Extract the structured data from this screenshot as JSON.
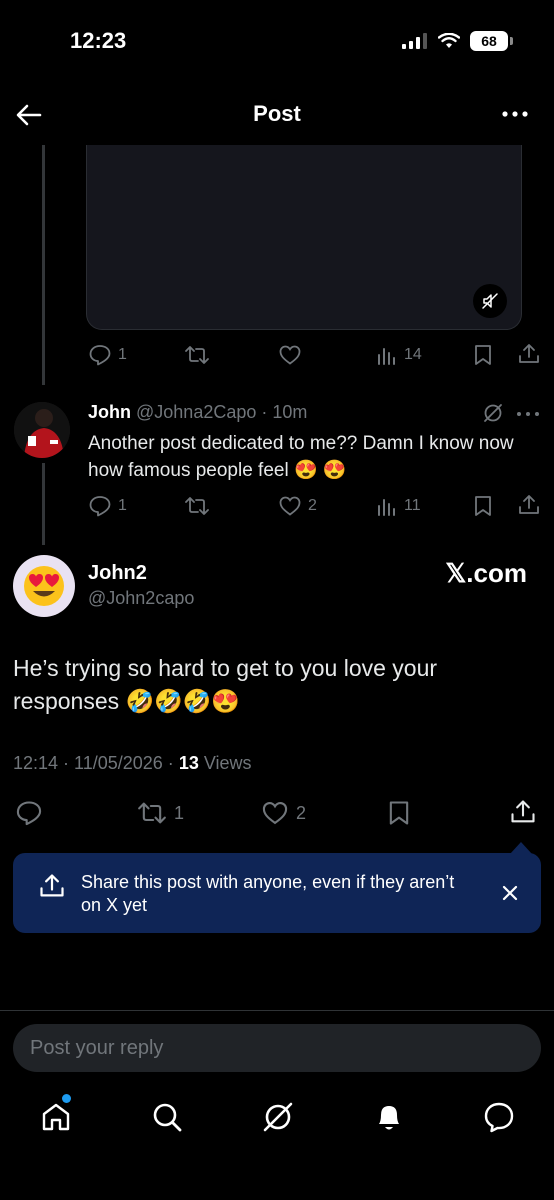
{
  "status_bar": {
    "time": "12:23",
    "battery": "68"
  },
  "header": {
    "title": "Post"
  },
  "media_post": {
    "actions": {
      "replies": "1",
      "views": "14"
    }
  },
  "reply": {
    "name": "John",
    "handle": "@Johna2Capo",
    "time": "· 10m",
    "text": "Another post dedicated to me?? Damn I know now how famous people feel 😍 😍",
    "actions": {
      "replies": "1",
      "likes": "2",
      "views": "11"
    }
  },
  "main_post": {
    "name": "John2",
    "handle": "@John2capo",
    "source": "𝕏.com",
    "text": "He’s trying so hard to get to you love your responses 🤣🤣🤣😍",
    "timestamp": "12:14 · 11/05/2026 ·",
    "views_count": "13",
    "views_label": "Views",
    "actions": {
      "reposts": "1",
      "likes": "2"
    }
  },
  "share_banner": {
    "text": "Share this post with anyone, even if they aren’t on X yet"
  },
  "reply_bar": {
    "placeholder": "Post your reply"
  },
  "nav": {
    "items": [
      "home-icon",
      "search-icon",
      "grok-icon",
      "notifications-icon",
      "messages-icon"
    ],
    "accent": "#1d9bf0"
  }
}
